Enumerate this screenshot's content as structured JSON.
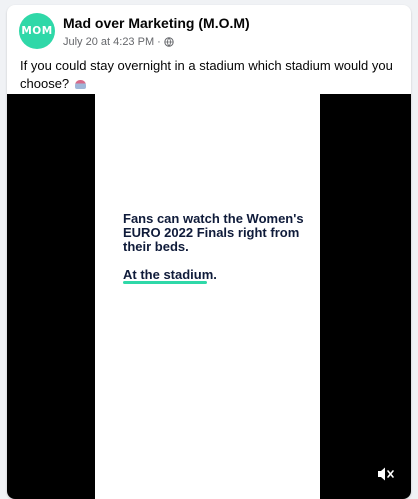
{
  "post": {
    "page_name": "Mad over Marketing (M.O.M)",
    "avatar_text": "MOM",
    "date": "July 20 at 4:23 PM",
    "separator": "·",
    "privacy_icon": "globe-icon",
    "caption": "If you could stay overnight in a stadium which stadium would you choose?",
    "caption_emoji": "stadium-emoji"
  },
  "video": {
    "headline": "Fans can watch the Women's EURO 2022 Finals right from their beds.",
    "tagline": "At the stadium.",
    "mute_icon": "speaker-muted-icon"
  },
  "colors": {
    "brand_teal": "#2fd8a8",
    "video_letterbox": "#000000",
    "headline_navy": "#0f1b3a"
  }
}
